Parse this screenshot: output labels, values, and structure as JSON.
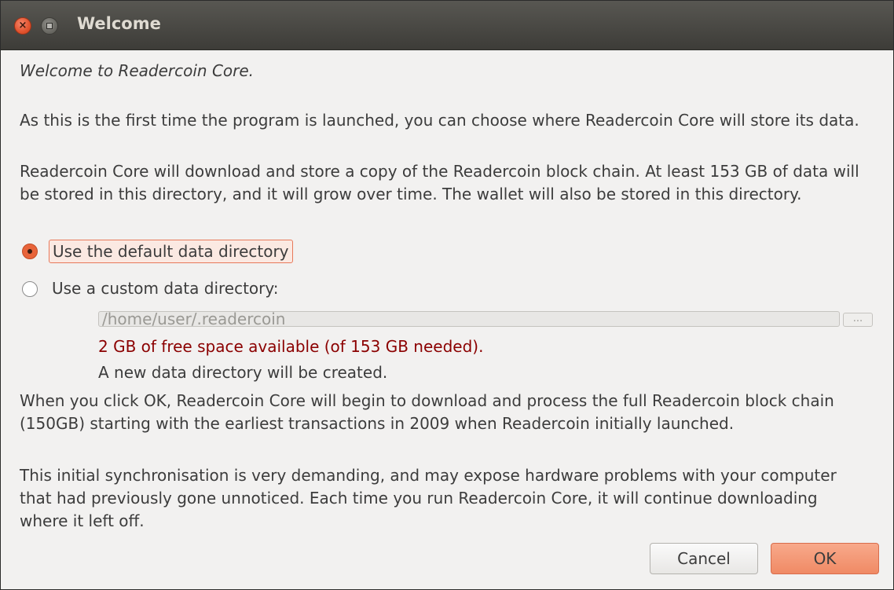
{
  "window": {
    "title": "Welcome",
    "close_glyph": "×"
  },
  "dialog": {
    "intro": "Welcome to Readercoin Core.",
    "para1": "As this is the first time the program is launched, you can choose where Readercoin Core will store its data.",
    "para2": "Readercoin Core will download and store a copy of the Readercoin block chain. At least 153 GB of data will be stored in this directory, and it will grow over time. The wallet will also be stored in this directory.",
    "options": {
      "default_label": "Use the default data directory",
      "default_selected": true,
      "custom_label": "Use a custom data directory:",
      "custom_selected": false
    },
    "path_value": "/home/user/.readercoin",
    "browse_label": "...",
    "freespace": "2 GB of free space available (of 153 GB needed).",
    "newdir": "A new data directory will be created.",
    "para3": "When you click OK, Readercoin Core will begin to download and process the full Readercoin block chain (150GB) starting with the earliest transactions in 2009 when Readercoin initially launched.",
    "para4": "This initial synchronisation is very demanding, and may expose hardware problems with your computer that had previously gone unnoticed. Each time you run Readercoin Core, it will continue downloading where it left off."
  },
  "buttons": {
    "cancel": "Cancel",
    "ok": "OK"
  },
  "colors": {
    "accent": "#e8643a",
    "warning_text": "#8b0000",
    "titlebar": "#4a4944"
  }
}
